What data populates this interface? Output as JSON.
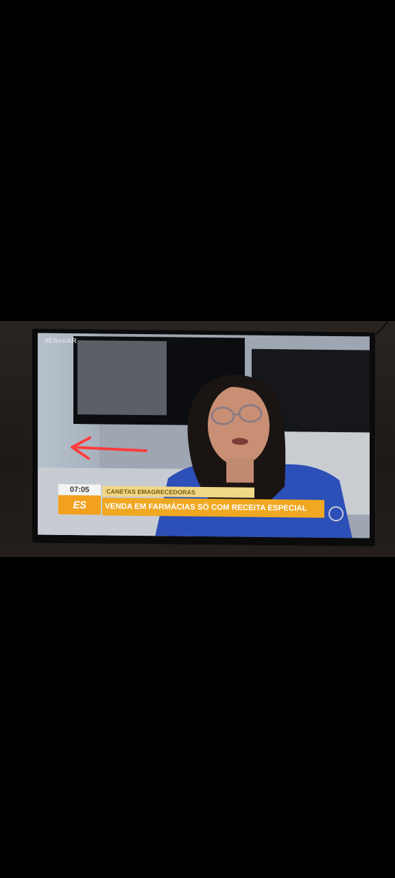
{
  "overlay": {
    "hashtag": "#ESnoAR",
    "time": "07:05",
    "logo": "ES",
    "topic": "CANETAS EMAGRECEDORAS",
    "headline": "VENDA EM FARMÁCIAS SÓ COM RECEITA ESPECIAL"
  },
  "annotation": {
    "arrow_color": "#ff3b3b",
    "icon": "arrow-left-icon"
  },
  "colors": {
    "headline_bar": "#f0a822",
    "topic_bar": "#f1d886",
    "background": "#000000"
  }
}
